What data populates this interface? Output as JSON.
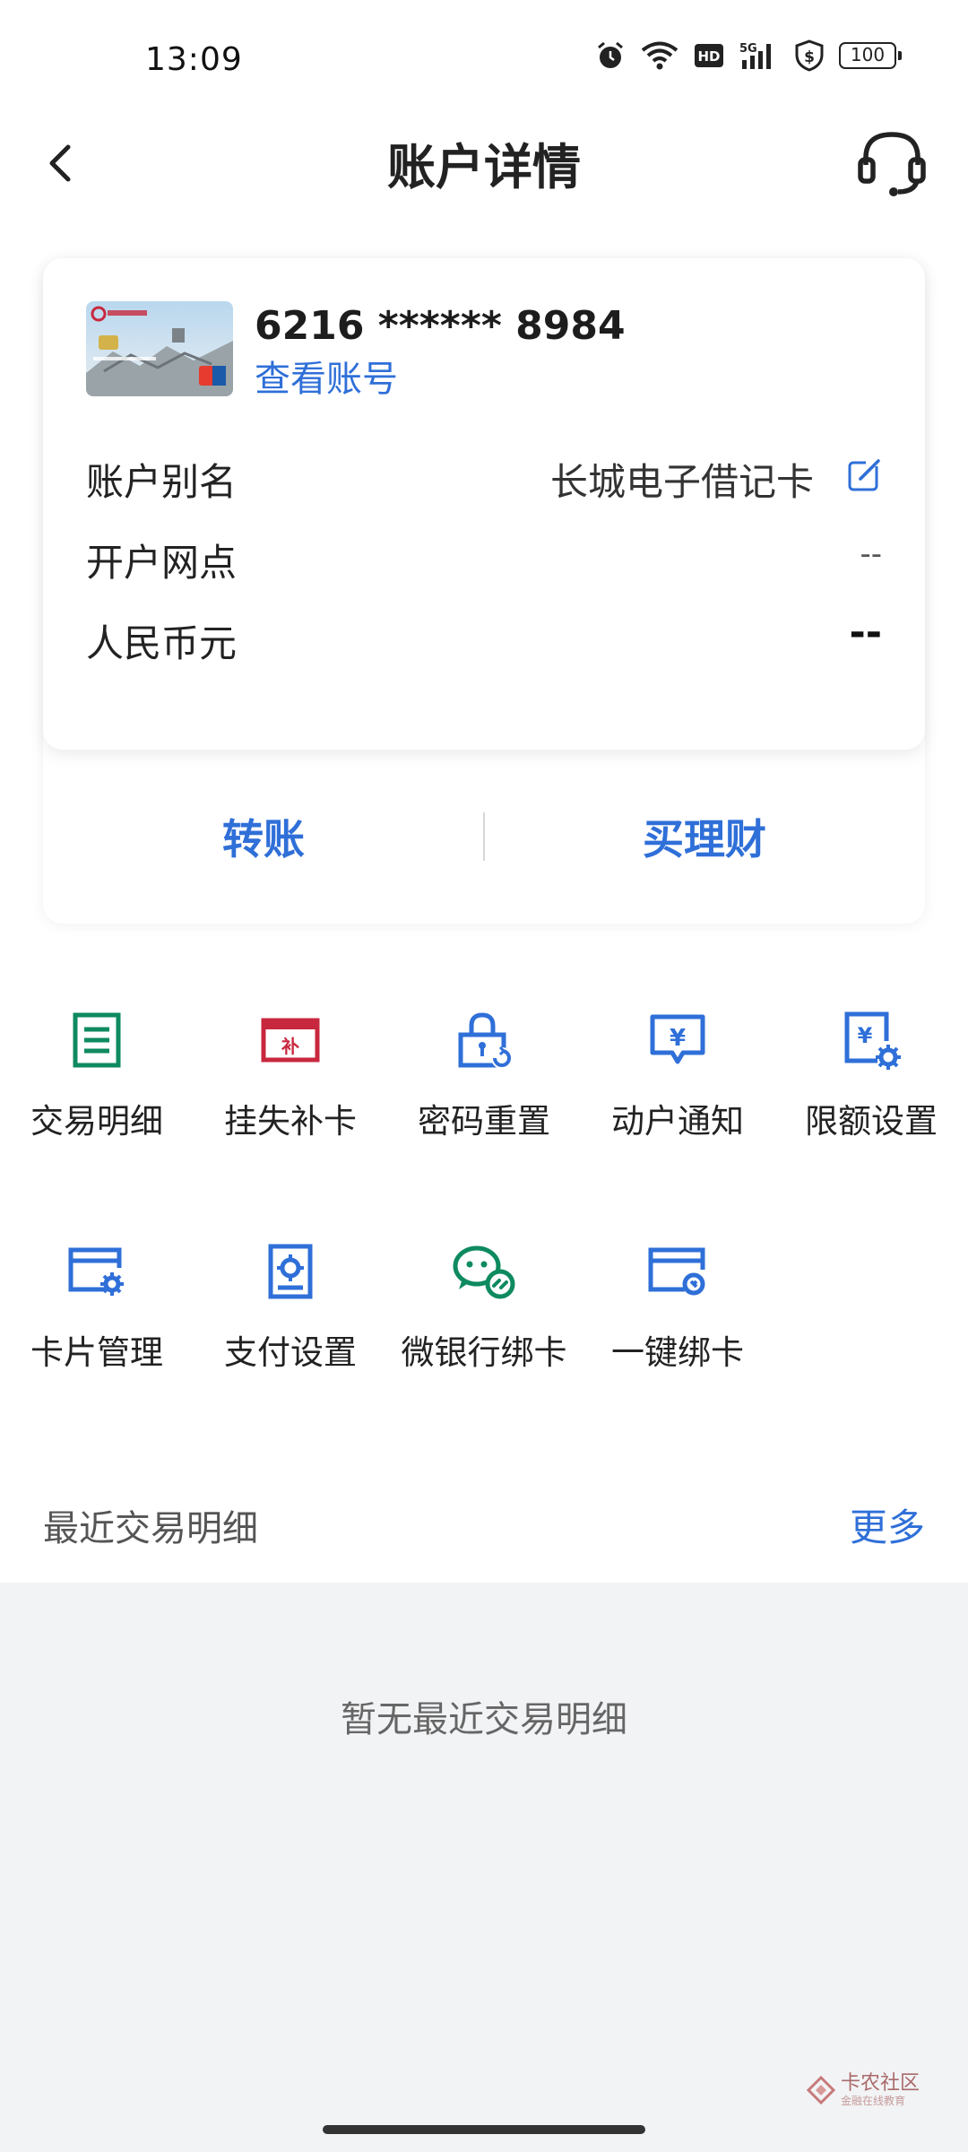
{
  "status_bar": {
    "time": "13:09",
    "battery": "100"
  },
  "nav": {
    "title": "账户详情"
  },
  "card": {
    "number": "6216 ****** 8984",
    "view_account_link": "查看账号",
    "rows": [
      {
        "label": "账户别名",
        "value": "长城电子借记卡"
      },
      {
        "label": "开户网点",
        "value": "--"
      },
      {
        "label": "人民币元",
        "value": "--"
      }
    ],
    "actions": {
      "transfer": "转账",
      "buy_wealth": "买理财"
    }
  },
  "functions": [
    {
      "label": "交易明细",
      "icon": "transaction-list-icon",
      "color": "#0e8a5f"
    },
    {
      "label": "挂失补卡",
      "icon": "report-loss-icon",
      "color": "#c8283e"
    },
    {
      "label": "密码重置",
      "icon": "password-reset-icon",
      "color": "#2f6fd8"
    },
    {
      "label": "动户通知",
      "icon": "account-notice-icon",
      "color": "#2f6fd8"
    },
    {
      "label": "限额设置",
      "icon": "limit-setting-icon",
      "color": "#2f6fd8"
    },
    {
      "label": "卡片管理",
      "icon": "card-manage-icon",
      "color": "#2f6fd8"
    },
    {
      "label": "支付设置",
      "icon": "payment-setting-icon",
      "color": "#2f6fd8"
    },
    {
      "label": "微银行绑卡",
      "icon": "wechat-bind-icon",
      "color": "#0e8a5f"
    },
    {
      "label": "一键绑卡",
      "icon": "one-click-bind-icon",
      "color": "#2f6fd8"
    }
  ],
  "recent": {
    "title": "最近交易明细",
    "more": "更多",
    "empty": "暂无最近交易明细"
  },
  "watermark": {
    "text": "卡农社区",
    "sub": "金融在线教育"
  }
}
